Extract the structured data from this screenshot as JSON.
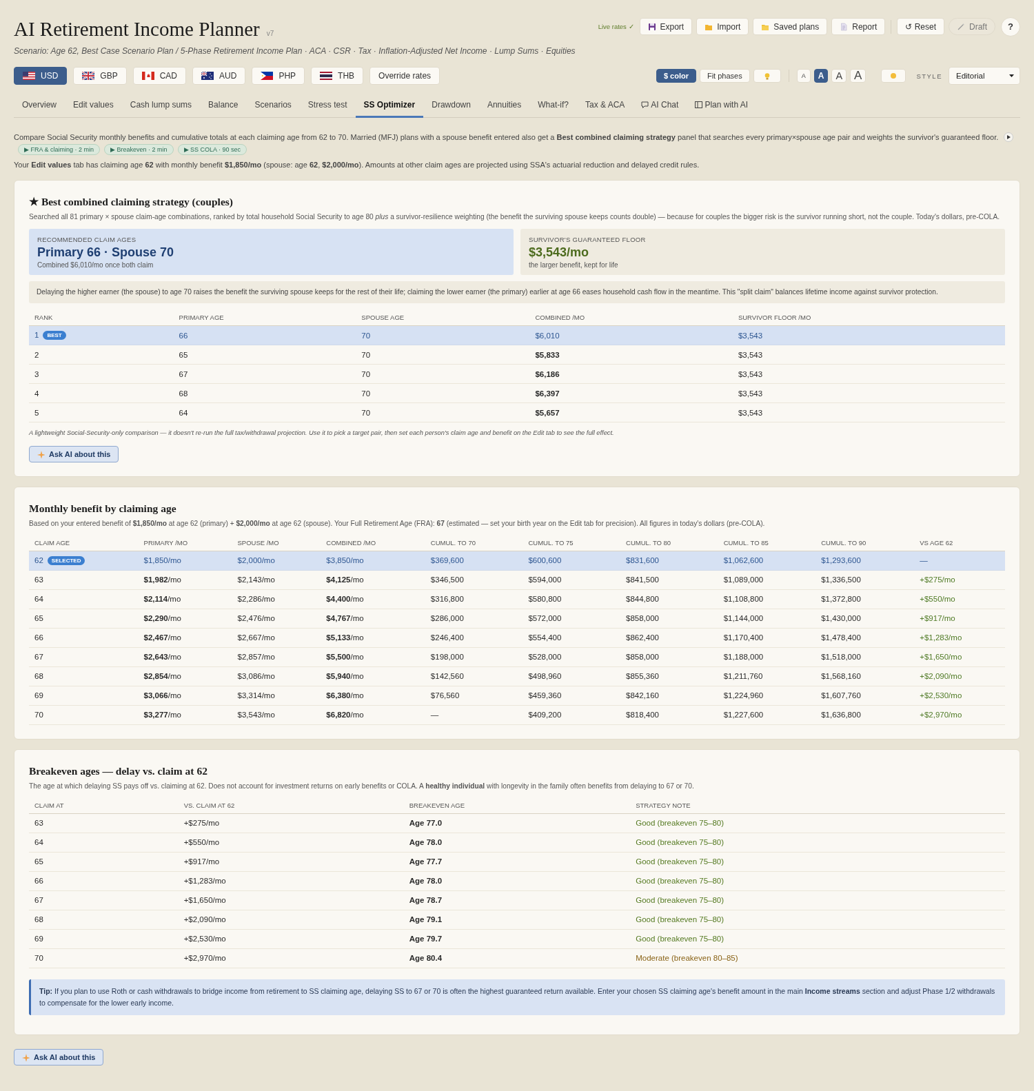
{
  "header": {
    "title": "AI Retirement Income Planner",
    "version": "v7",
    "scenario": "Scenario: Age 62, Best Case Scenario Plan / 5-Phase Retirement Income Plan · ACA · CSR · Tax · Inflation-Adjusted Net Income · Lump Sums · Equities",
    "live_rates": "Live rates ✓",
    "actions": [
      {
        "label": "Export",
        "kind": "export"
      },
      {
        "label": "Import",
        "kind": "import"
      },
      {
        "label": "Saved plans",
        "kind": "saved"
      },
      {
        "label": "Report",
        "kind": "report"
      },
      {
        "label": "↺ Reset",
        "kind": "reset"
      },
      {
        "label": "Draft",
        "kind": "draft"
      }
    ],
    "help": "?"
  },
  "currencies": [
    {
      "code": "USD",
      "kind": "us",
      "selected": true
    },
    {
      "code": "GBP",
      "kind": "gb",
      "selected": false
    },
    {
      "code": "CAD",
      "kind": "ca",
      "selected": false
    },
    {
      "code": "AUD",
      "kind": "au",
      "selected": false
    },
    {
      "code": "PHP",
      "kind": "ph",
      "selected": false
    },
    {
      "code": "THB",
      "kind": "th",
      "selected": false
    }
  ],
  "override_rates": "Override rates",
  "display": {
    "color_button": {
      "label": "$ color",
      "on": true
    },
    "fit_phases": "Fit phases",
    "text_sizes": [
      {
        "label": "A",
        "selected": false
      },
      {
        "label": "A",
        "selected": true
      },
      {
        "label": "A",
        "selected": false
      },
      {
        "label": "A",
        "selected": false
      }
    ],
    "style_label": "STYLE",
    "style_value": "Editorial"
  },
  "tabs": [
    {
      "label": "Overview",
      "selected": false
    },
    {
      "label": "Edit values",
      "selected": false
    },
    {
      "label": "Cash lump sums",
      "selected": false
    },
    {
      "label": "Balance",
      "selected": false
    },
    {
      "label": "Scenarios",
      "selected": false
    },
    {
      "label": "Stress test",
      "selected": false
    },
    {
      "label": "SS Optimizer",
      "selected": true
    },
    {
      "label": "Drawdown",
      "selected": false
    },
    {
      "label": "Annuities",
      "selected": false
    },
    {
      "label": "What-if?",
      "selected": false
    },
    {
      "label": "Tax & ACA",
      "selected": false
    },
    {
      "label": "AI Chat",
      "selected": false,
      "kind": "chat"
    },
    {
      "label": "Plan with AI",
      "selected": false,
      "kind": "panel"
    }
  ],
  "intro": {
    "text": "Compare Social Security monthly benefits and cumulative totals at each claiming age from 62 to 70. Married (MFJ) plans with a spouse benefit entered also get a **Best combined claiming strategy** panel that searches every primary×spouse age pair and weights the survivor's guaranteed floor.",
    "chips": [
      "▶ FRA & claiming · 2 min",
      "▶ Breakeven · 2 min",
      "▶ SS COLA · 90 sec"
    ],
    "note": "Your **Edit values** tab has claiming age **62** with monthly benefit **$1,850/mo** (spouse: age **62**, **$2,000/mo**). Amounts at other claim ages are projected using SSA's actuarial reduction and delayed credit rules."
  },
  "strategy": {
    "title": "★ Best combined claiming strategy (couples)",
    "description": "Searched all 81 primary × spouse claim-age combinations, ranked by total household Social Security to age 80 *plus* a survivor-resilience weighting (the benefit the surviving spouse keeps counts double) — because for couples the bigger risk is the survivor running short, not the couple. Today's dollars, pre-COLA.",
    "recommended": {
      "label": "RECOMMENDED CLAIM AGES",
      "value": "Primary 66 · Spouse 70",
      "sub": "Combined $6,010/mo once both claim"
    },
    "floor": {
      "label": "SURVIVOR'S GUARANTEED FLOOR",
      "value": "$3,543/mo",
      "sub": "the larger benefit, kept for life"
    },
    "explanation": "Delaying the higher earner (the spouse) to age 70 raises the benefit the surviving spouse keeps for the rest of their life; claiming the lower earner (the primary) earlier at age 66 eases household cash flow in the meantime. This \"split claim\" balances lifetime income against survivor protection.",
    "columns": [
      "RANK",
      "PRIMARY AGE",
      "SPOUSE AGE",
      "COMBINED /MO",
      "SURVIVOR FLOOR /MO"
    ],
    "rows": [
      {
        "rank": "1",
        "badge": "BEST",
        "primary": "66",
        "spouse": "70",
        "combined": "$6,010",
        "survivor": "$3,543",
        "selected": true
      },
      {
        "rank": "2",
        "primary": "65",
        "spouse": "70",
        "combined": "$5,833",
        "survivor": "$3,543",
        "selected": false
      },
      {
        "rank": "3",
        "primary": "67",
        "spouse": "70",
        "combined": "$6,186",
        "survivor": "$3,543",
        "selected": false
      },
      {
        "rank": "4",
        "primary": "68",
        "spouse": "70",
        "combined": "$6,397",
        "survivor": "$3,543",
        "selected": false
      },
      {
        "rank": "5",
        "primary": "64",
        "spouse": "70",
        "combined": "$5,657",
        "survivor": "$3,543",
        "selected": false
      }
    ],
    "footnote": "A lightweight Social-Security-only comparison — it doesn't re-run the full tax/withdrawal projection. Use it to pick a target pair, then set each person's claim age and benefit on the Edit tab to see the full effect.",
    "ask": "Ask AI about this"
  },
  "benefits": {
    "title": "Monthly benefit by claiming age",
    "description": "Based on your entered benefit of **$1,850/mo** at age 62 (primary) + **$2,000/mo** at age 62 (spouse). Your Full Retirement Age (FRA): **67** (estimated — set your birth year on the Edit tab for precision). All figures in today's dollars (pre-COLA).",
    "columns": [
      "CLAIM AGE",
      "PRIMARY /MO",
      "SPOUSE /MO",
      "COMBINED /MO",
      "CUMUL. TO 70",
      "CUMUL. TO 75",
      "CUMUL. TO 80",
      "CUMUL. TO 85",
      "CUMUL. TO 90",
      "VS AGE 62"
    ],
    "rows": [
      {
        "badge": "SELECTED",
        "selected": true,
        "cells": [
          "62",
          "$1,850/mo",
          "$2,000/mo",
          "$3,850/mo",
          "$369,600",
          "$600,600",
          "$831,600",
          "$1,062,600",
          "$1,293,600",
          "—"
        ]
      },
      {
        "selected": false,
        "cells": [
          "63",
          "**$1,982**/mo",
          "$2,143/mo",
          "**$4,125**/mo",
          "$346,500",
          "$594,000",
          "$841,500",
          "$1,089,000",
          "$1,336,500",
          "+$275/mo"
        ]
      },
      {
        "selected": false,
        "cells": [
          "64",
          "**$2,114**/mo",
          "$2,286/mo",
          "**$4,400**/mo",
          "$316,800",
          "$580,800",
          "$844,800",
          "$1,108,800",
          "$1,372,800",
          "+$550/mo"
        ]
      },
      {
        "selected": false,
        "cells": [
          "65",
          "**$2,290**/mo",
          "$2,476/mo",
          "**$4,767**/mo",
          "$286,000",
          "$572,000",
          "$858,000",
          "$1,144,000",
          "$1,430,000",
          "+$917/mo"
        ]
      },
      {
        "selected": false,
        "cells": [
          "66",
          "**$2,467**/mo",
          "$2,667/mo",
          "**$5,133**/mo",
          "$246,400",
          "$554,400",
          "$862,400",
          "$1,170,400",
          "$1,478,400",
          "+$1,283/mo"
        ]
      },
      {
        "selected": false,
        "cells": [
          "67",
          "**$2,643**/mo",
          "$2,857/mo",
          "**$5,500**/mo",
          "$198,000",
          "$528,000",
          "$858,000",
          "$1,188,000",
          "$1,518,000",
          "+$1,650/mo"
        ]
      },
      {
        "selected": false,
        "cells": [
          "68",
          "**$2,854**/mo",
          "$3,086/mo",
          "**$5,940**/mo",
          "$142,560",
          "$498,960",
          "$855,360",
          "$1,211,760",
          "$1,568,160",
          "+$2,090/mo"
        ]
      },
      {
        "selected": false,
        "cells": [
          "69",
          "**$3,066**/mo",
          "$3,314/mo",
          "**$6,380**/mo",
          "$76,560",
          "$459,360",
          "$842,160",
          "$1,224,960",
          "$1,607,760",
          "+$2,530/mo"
        ]
      },
      {
        "selected": false,
        "cells": [
          "70",
          "**$3,277**/mo",
          "$3,543/mo",
          "**$6,820**/mo",
          "—",
          "$409,200",
          "$818,400",
          "$1,227,600",
          "$1,636,800",
          "+$2,970/mo"
        ]
      }
    ]
  },
  "breakeven": {
    "title": "Breakeven ages — delay vs. claim at 62",
    "description": "The age at which delaying SS pays off vs. claiming at 62. Does not account for investment returns on early benefits or COLA. A **healthy individual** with longevity in the family often benefits from delaying to 67 or 70.",
    "columns": [
      "CLAIM AT",
      "VS. CLAIM AT 62",
      "BREAKEVEN AGE",
      "STRATEGY NOTE"
    ],
    "rows": [
      {
        "claim": "63",
        "vs": "+$275/mo",
        "age": "Age 77.0",
        "note": "Good (breakeven 75–80)",
        "kind": "good"
      },
      {
        "claim": "64",
        "vs": "+$550/mo",
        "age": "Age 78.0",
        "note": "Good (breakeven 75–80)",
        "kind": "good"
      },
      {
        "claim": "65",
        "vs": "+$917/mo",
        "age": "Age 77.7",
        "note": "Good (breakeven 75–80)",
        "kind": "good"
      },
      {
        "claim": "66",
        "vs": "+$1,283/mo",
        "age": "Age 78.0",
        "note": "Good (breakeven 75–80)",
        "kind": "good"
      },
      {
        "claim": "67",
        "vs": "+$1,650/mo",
        "age": "Age 78.7",
        "note": "Good (breakeven 75–80)",
        "kind": "good"
      },
      {
        "claim": "68",
        "vs": "+$2,090/mo",
        "age": "Age 79.1",
        "note": "Good (breakeven 75–80)",
        "kind": "good"
      },
      {
        "claim": "69",
        "vs": "+$2,530/mo",
        "age": "Age 79.7",
        "note": "Good (breakeven 75–80)",
        "kind": "good"
      },
      {
        "claim": "70",
        "vs": "+$2,970/mo",
        "age": "Age 80.4",
        "note": "Moderate (breakeven 80–85)",
        "kind": "moderate"
      }
    ],
    "tip": "**Tip:** If you plan to use Roth or cash withdrawals to bridge income from retirement to SS claiming age, delaying SS to 67 or 70 is often the highest guaranteed return available. Enter your chosen SS claiming age's benefit amount in the main **Income streams** section and adjust Phase 1/2 withdrawals to compensate for the lower early income."
  },
  "footer_ask": "Ask AI about this"
}
